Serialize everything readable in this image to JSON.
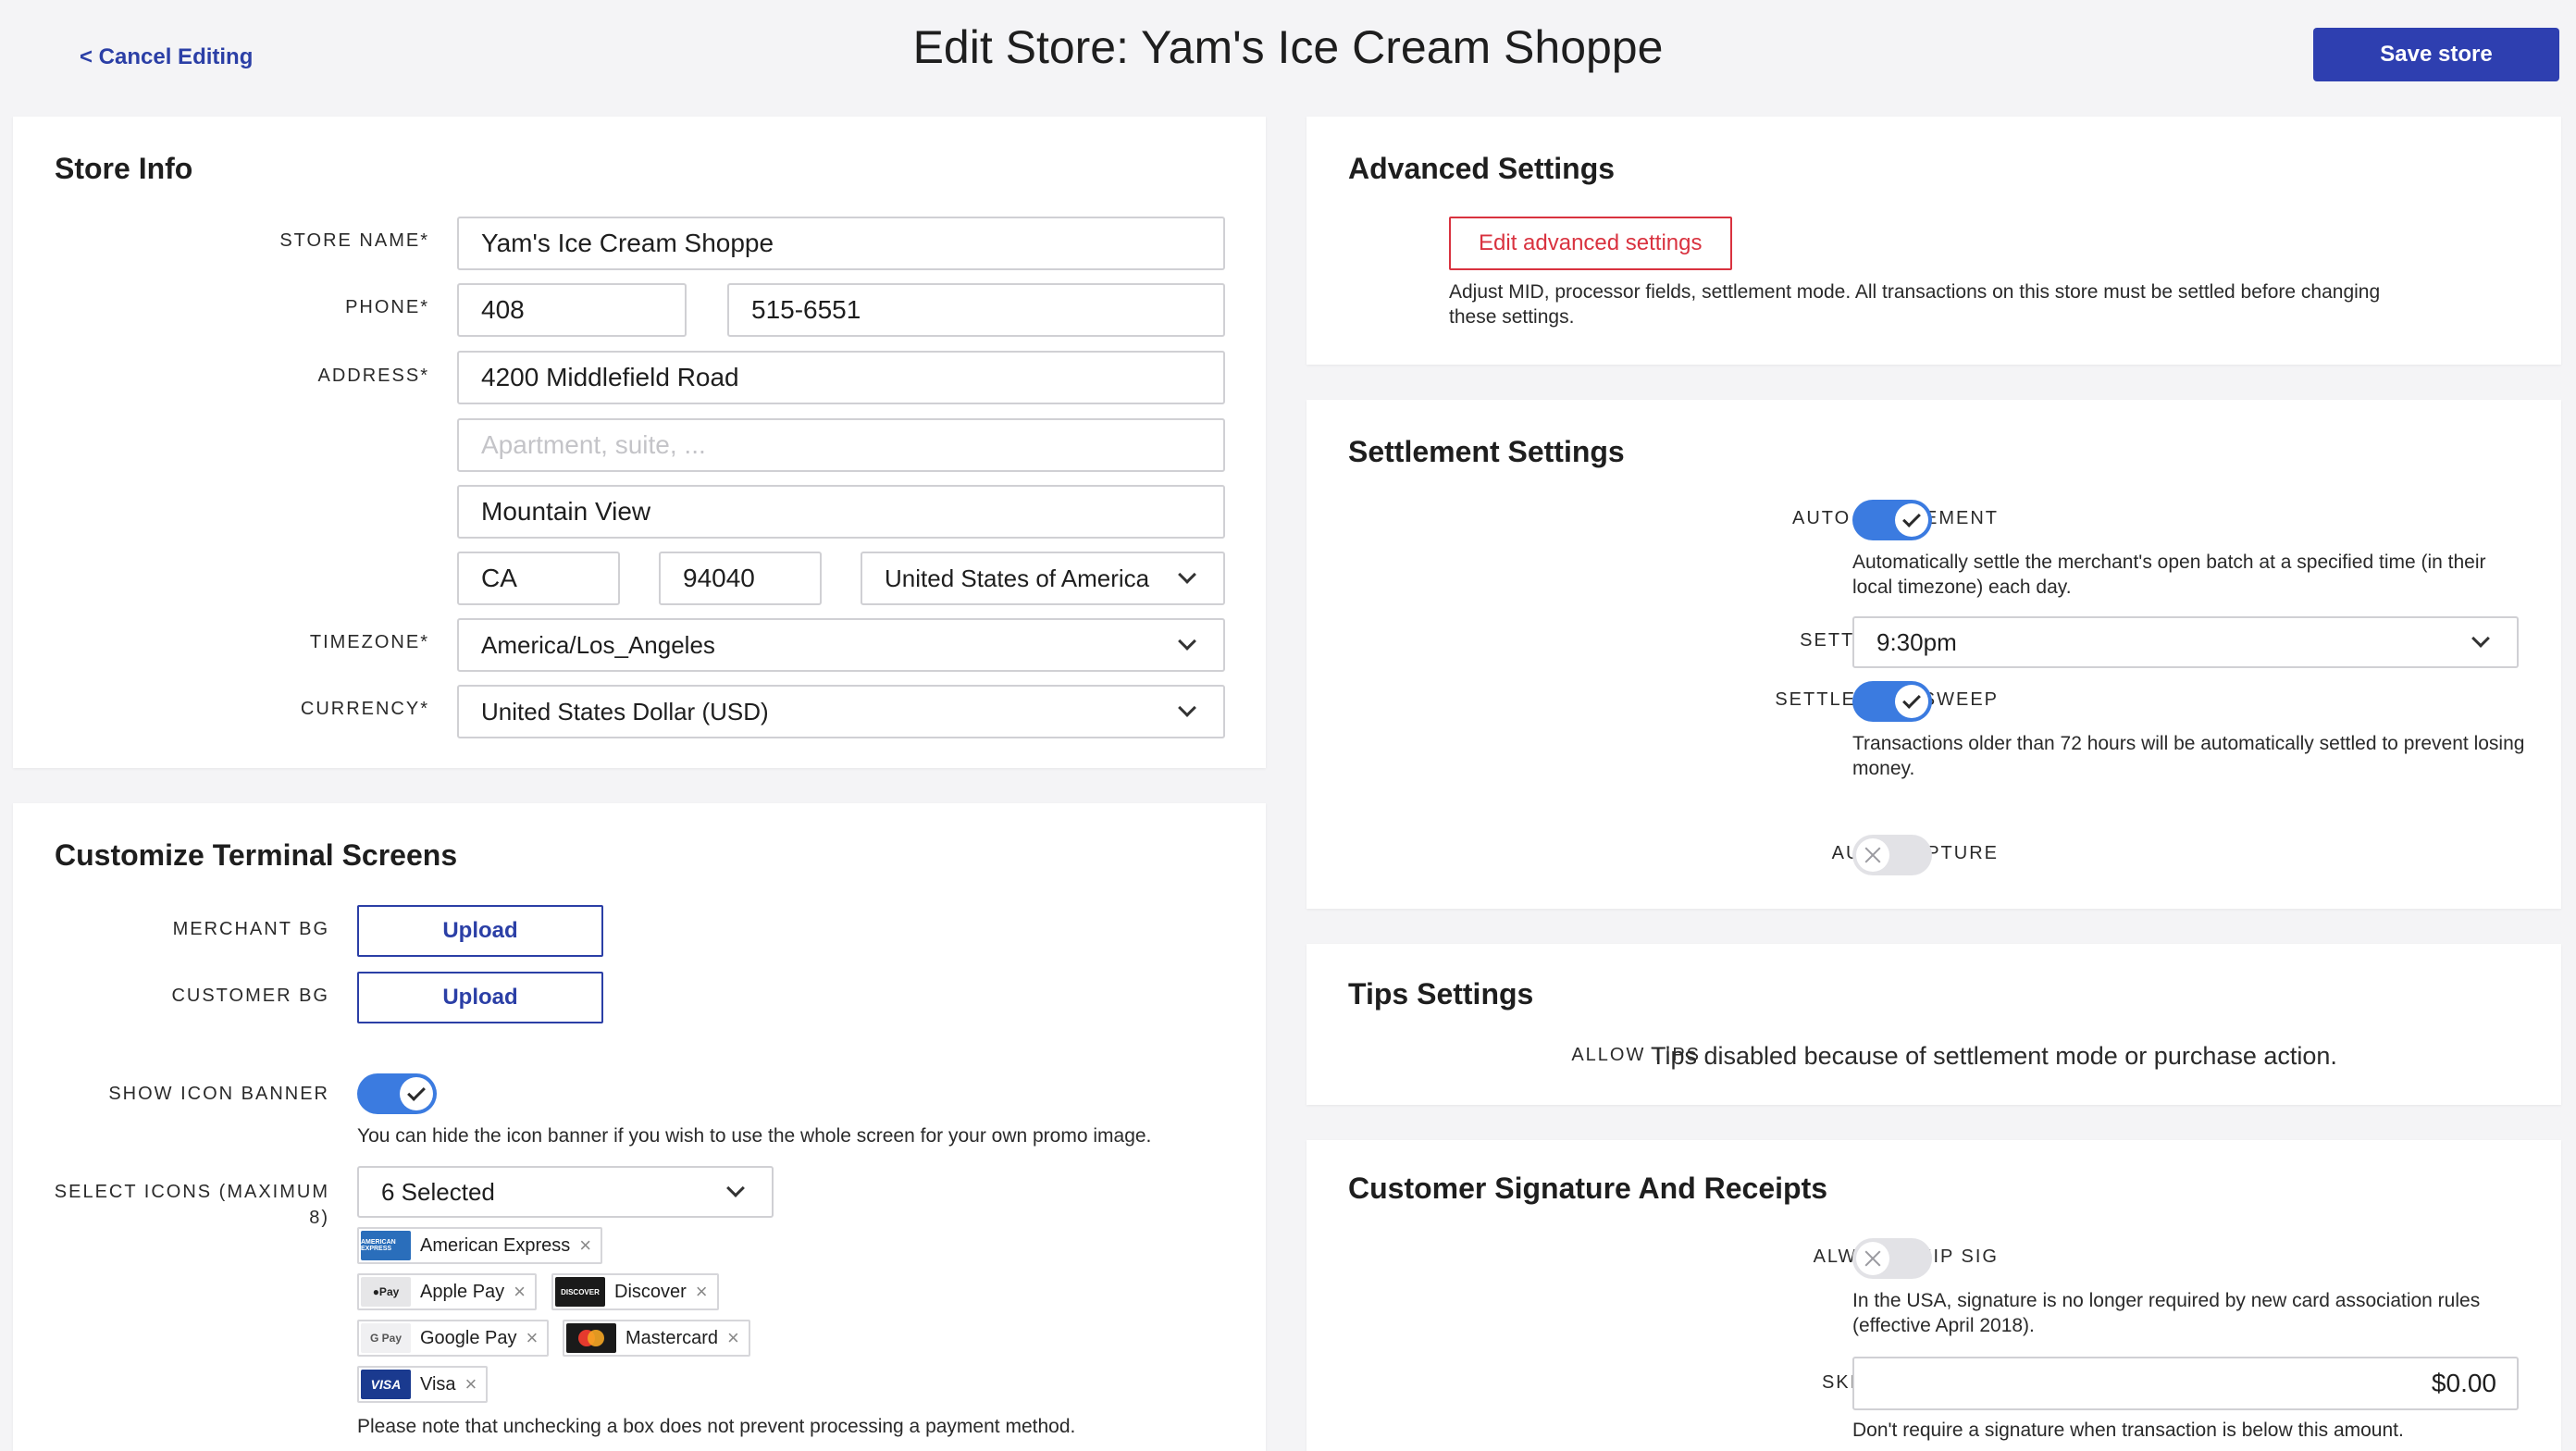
{
  "header": {
    "cancel": "< Cancel Editing",
    "title": "Edit Store: Yam's Ice Cream Shoppe",
    "save": "Save store"
  },
  "store_info": {
    "title": "Store Info",
    "labels": {
      "name": "STORE NAME*",
      "phone": "PHONE*",
      "address": "ADDRESS*",
      "timezone": "TIMEZONE*",
      "currency": "CURRENCY*"
    },
    "name": "Yam's Ice Cream Shoppe",
    "phone_area": "408",
    "phone_number": "515-6551",
    "address1": "4200 Middlefield Road",
    "address2_placeholder": "Apartment, suite, ...",
    "city": "Mountain View",
    "state": "CA",
    "zip": "94040",
    "country": "United States of America",
    "timezone": "America/Los_Angeles",
    "currency": "United States Dollar (USD)"
  },
  "terminal": {
    "title": "Customize Terminal Screens",
    "labels": {
      "merchant_bg": "MERCHANT BG",
      "customer_bg": "CUSTOMER BG",
      "icon_banner": "SHOW ICON BANNER",
      "select_icons": "SELECT ICONS (MAXIMUM 8)"
    },
    "upload": "Upload",
    "icon_banner_help": "You can hide the icon banner if you wish to use the whole screen for your own promo image.",
    "icons_selected": "6 Selected",
    "chips": [
      {
        "label": "American Express",
        "logo": "AMERICAN EXPRESS",
        "color": "#2a6ebb"
      },
      {
        "label": "Apple Pay",
        "logo": "●Pay",
        "color": "#e6e6e8"
      },
      {
        "label": "Discover",
        "logo": "DISCOVER",
        "color": "#1a1a1a"
      },
      {
        "label": "Google Pay",
        "logo": "G Pay",
        "color": "#f0f0f2"
      },
      {
        "label": "Mastercard",
        "logo": "MC",
        "color": "#1a1a1a"
      },
      {
        "label": "Visa",
        "logo": "VISA",
        "color": "#1a3a8f"
      }
    ],
    "chip_remove": "×",
    "note": "Please note that unchecking a box does not prevent processing a payment method."
  },
  "advanced": {
    "title": "Advanced Settings",
    "button": "Edit advanced settings",
    "help": "Adjust MID, processor fields, settlement mode. All transactions on this store must be settled before changing these settings."
  },
  "settlement": {
    "title": "Settlement Settings",
    "labels": {
      "auto_settlement": "AUTO SETTLEMENT",
      "settlement_time": "SETTLEMENT TIME",
      "settlement_sweep": "SETTLEMENT SWEEP",
      "auto_capture": "AUTO CAPTURE"
    },
    "auto_settlement_help": "Automatically settle the merchant's open batch at a specified time (in their local timezone) each day.",
    "settlement_time": "9:30pm",
    "sweep_help": "Transactions older than 72 hours will be automatically settled to prevent losing money."
  },
  "tips": {
    "title": "Tips Settings",
    "label": "ALLOW TIPS",
    "text": "Tips disabled because of settlement mode or purchase action."
  },
  "signature": {
    "title": "Customer Signature And Receipts",
    "labels": {
      "always_skip": "ALWAYS SKIP SIG",
      "skip_below": "SKIP SIG BELOW"
    },
    "always_skip_help": "In the USA, signature is no longer required by new card association rules (effective April 2018).",
    "skip_below_value": "$0.00",
    "skip_below_help": "Don't require a signature when transaction is below this amount."
  }
}
